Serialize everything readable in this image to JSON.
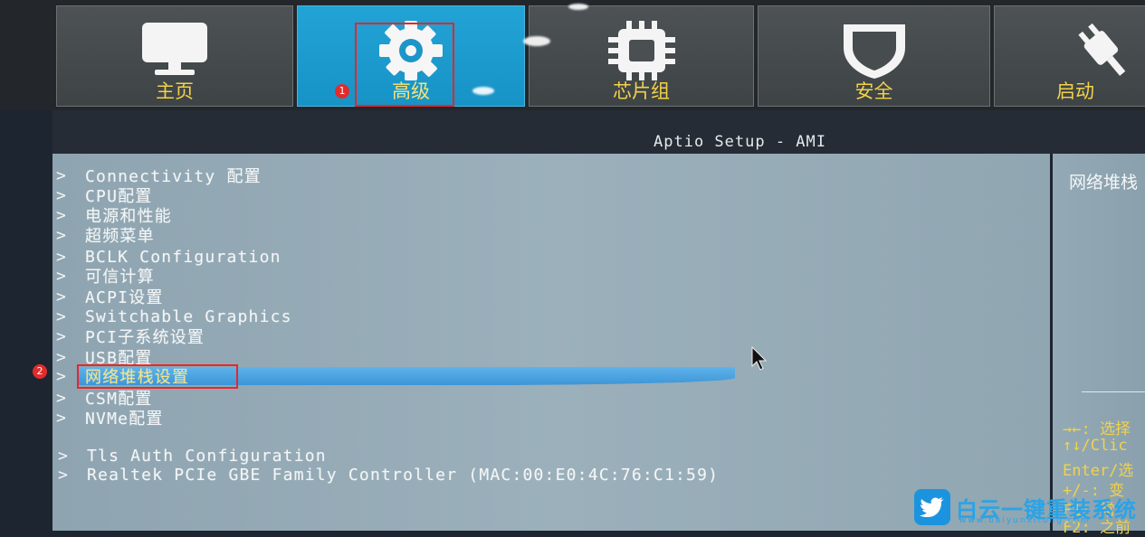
{
  "tabs": [
    {
      "label": "主页",
      "icon": "monitor-icon",
      "active": false
    },
    {
      "label": "高级",
      "icon": "gear-icon",
      "active": true
    },
    {
      "label": "芯片组",
      "icon": "chip-icon",
      "active": false
    },
    {
      "label": "安全",
      "icon": "shield-icon",
      "active": false
    },
    {
      "label": "启动",
      "icon": "power-plug-icon",
      "active": false
    }
  ],
  "annotations": {
    "badge1": "1",
    "badge2": "2"
  },
  "title": "Aptio Setup - AMI",
  "menu": {
    "arrow": ">",
    "items": [
      "Connectivity 配置",
      "CPU配置",
      "电源和性能",
      "超频菜单",
      "BCLK Configuration",
      "可信计算",
      "ACPI设置",
      "Switchable Graphics",
      "PCI子系统设置",
      "USB配置",
      "网络堆栈设置",
      "CSM配置",
      "NVMe配置",
      "Tls Auth Configuration",
      "Realtek PCIe GBE Family Controller (MAC:00:E0:4C:76:C1:59)"
    ],
    "selected_index": 10
  },
  "side_panel": {
    "title": "网络堆栈",
    "help": [
      "→←: 选择",
      "↑↓/Clic",
      "Enter/选",
      "+/-: 变",
      "F1: 常",
      "F2: 之前"
    ]
  },
  "watermark": {
    "name": "白云一键重装系统",
    "url": "www.baiyunxitong.com"
  },
  "colors": {
    "accent": "#1793c6",
    "label_yellow": "#f2d24a",
    "highlight_box": "#e8262a",
    "menu_bg": "#9bb0bb"
  }
}
